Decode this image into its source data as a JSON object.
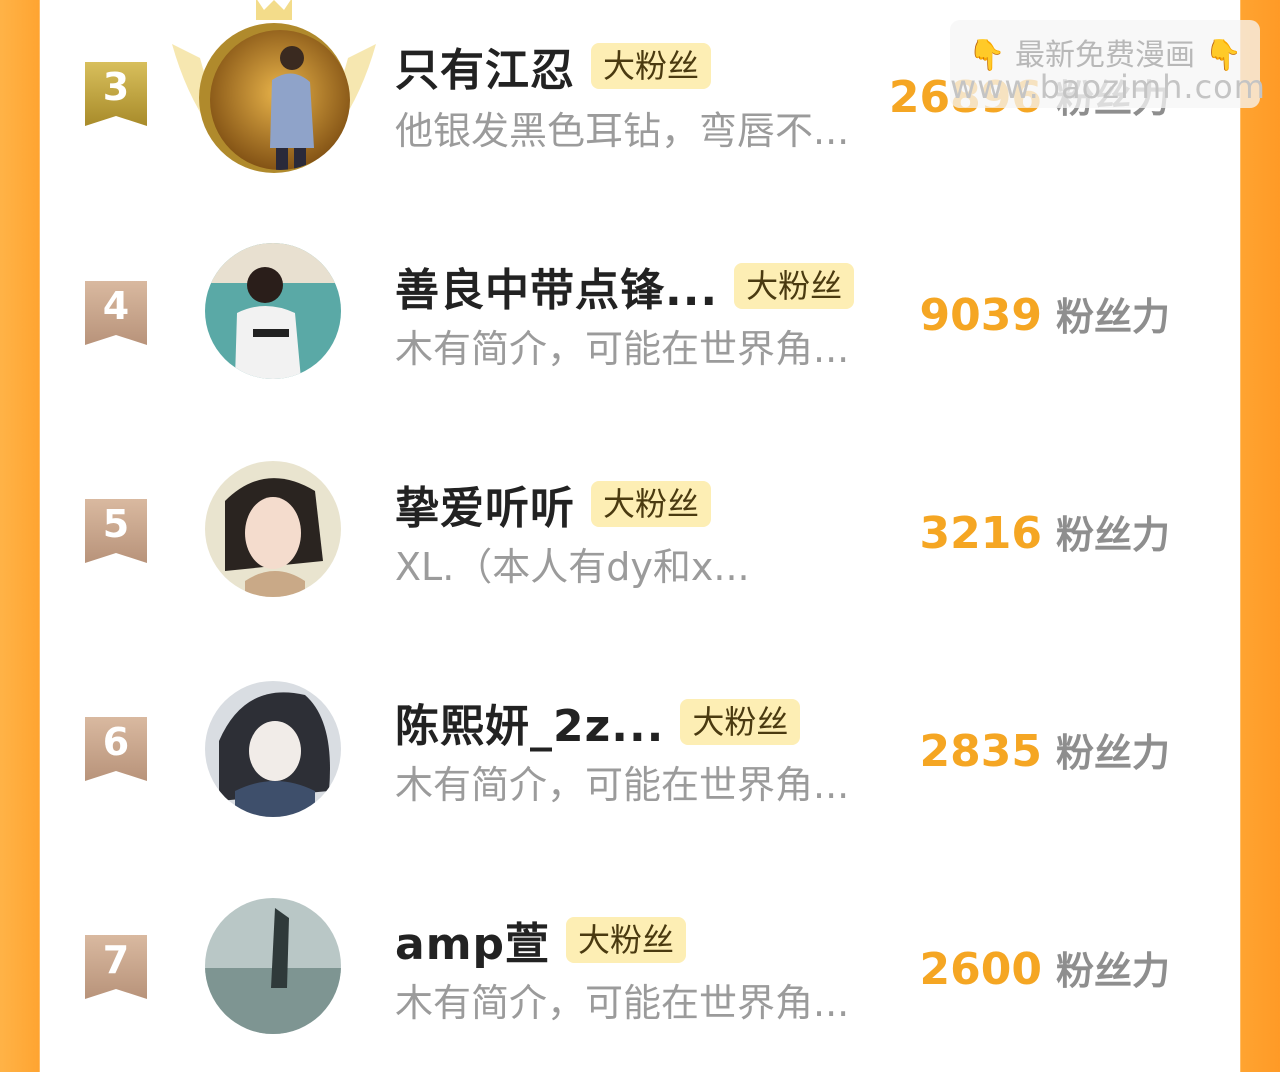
{
  "colors": {
    "accent": "#f5a623",
    "side_bar": "#ffa431",
    "tag_bg": "#fdeeb4",
    "rank_gold": "#c9a93c",
    "rank_bronze": "#c9a58a"
  },
  "watermark": {
    "line1": "最新免费漫画",
    "line2": "www.baozimh.com",
    "icon": "pointing-down-hand-icon"
  },
  "rows": [
    {
      "rank": "3",
      "name": "只有江忍",
      "tag": "大粉丝",
      "desc": "他银发黑色耳钻，弯唇不...",
      "score": "26896",
      "unit": "粉丝力"
    },
    {
      "rank": "4",
      "name": "善良中带点锋...",
      "tag": "大粉丝",
      "desc": "木有简介，可能在世界角...",
      "score": "9039",
      "unit": "粉丝力"
    },
    {
      "rank": "5",
      "name": "挚爱听听",
      "tag": "大粉丝",
      "desc": "XL.（本人有dy和x...",
      "score": "3216",
      "unit": "粉丝力"
    },
    {
      "rank": "6",
      "name": "陈熙妍_2z...",
      "tag": "大粉丝",
      "desc": "木有简介，可能在世界角...",
      "score": "2835",
      "unit": "粉丝力"
    },
    {
      "rank": "7",
      "name": "amp萱",
      "tag": "大粉丝",
      "desc": "木有简介，可能在世界角...",
      "score": "2600",
      "unit": "粉丝力"
    }
  ]
}
